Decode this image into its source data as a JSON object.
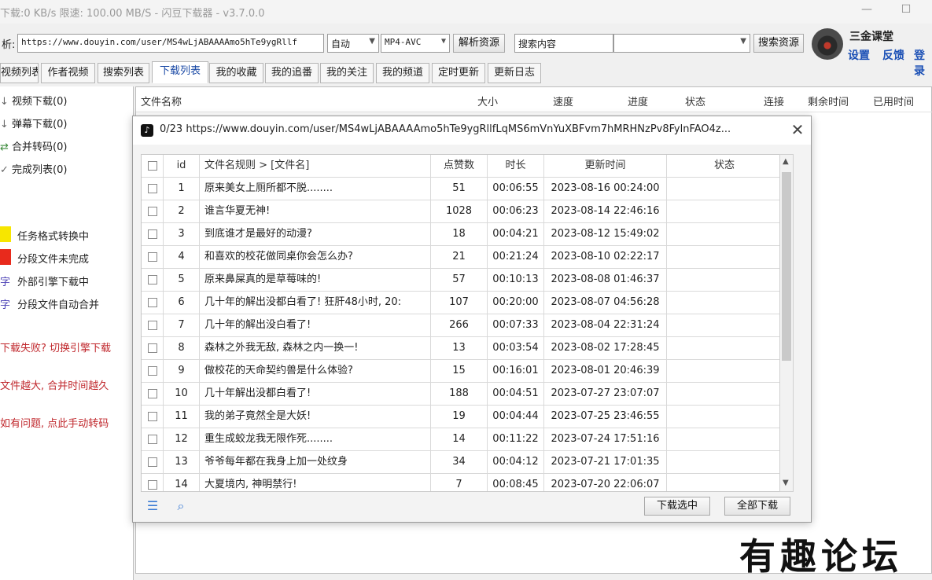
{
  "window": {
    "title": "下载:0 KB/s  限速: 100.00 MB/S  - 闪豆下载器 - v3.7.0.0"
  },
  "toolbar": {
    "parse_label": "析:",
    "url_value": "https://www.douyin.com/user/MS4wLjABAAAAmo5hTe9ygRllf",
    "mode_value": "自动",
    "format_value": "MP4-AVC",
    "parse_button": "解析资源",
    "search_input_value": "搜索内容",
    "search_select_value": "",
    "search_button": "搜索资源"
  },
  "user": {
    "name": "三金课堂",
    "settings": "设置",
    "feedback": "反馈",
    "login": "登录"
  },
  "tabs": [
    {
      "label": "视频列表"
    },
    {
      "label": "作者视频"
    },
    {
      "label": "搜索列表"
    },
    {
      "label": "下载列表"
    },
    {
      "label": "我的收藏"
    },
    {
      "label": "我的追番"
    },
    {
      "label": "我的关注"
    },
    {
      "label": "我的频道"
    },
    {
      "label": "定时更新"
    },
    {
      "label": "更新日志"
    }
  ],
  "sidebar": {
    "items": [
      {
        "icon": "↓",
        "label": "视频下载(0)"
      },
      {
        "icon": "↓",
        "label": "弹幕下载(0)"
      },
      {
        "icon": "⇄",
        "label": "合并转码(0)"
      },
      {
        "icon": "✓",
        "label": "完成列表(0)"
      }
    ],
    "legend": [
      {
        "color": "#f7e600",
        "label": "任务格式转换中"
      },
      {
        "color": "#e82a1c",
        "label": "分段文件未完成"
      },
      {
        "prefix": "字",
        "label": "外部引擎下载中"
      },
      {
        "prefix": "字",
        "label": "分段文件自动合并"
      }
    ],
    "tips": [
      "下载失败? 切换引擎下载",
      "文件越大, 合并时间越久",
      "如有问题, 点此手动转码"
    ]
  },
  "main_header": [
    "文件名称",
    "大小",
    "速度",
    "进度",
    "状态",
    "连接",
    "剩余时间",
    "已用时间"
  ],
  "dialog": {
    "title": "0/23 https://www.douyin.com/user/MS4wLjABAAAAmo5hTe9ygRllfLqMS6mVnYuXBFvm7hMRHNzPv8FylnFAO4z...",
    "columns": [
      "id",
      "文件名规则  >  [文件名]",
      "点赞数",
      "时长",
      "更新时间",
      "状态"
    ],
    "rows": [
      {
        "id": "1",
        "name": "原来美女上厕所都不脱........",
        "likes": "51",
        "duration": "00:06:55",
        "time": "2023-08-16 00:24:00",
        "status": ""
      },
      {
        "id": "2",
        "name": "谁言华夏无神!",
        "likes": "1028",
        "duration": "00:06:23",
        "time": "2023-08-14 22:46:16",
        "status": ""
      },
      {
        "id": "3",
        "name": "到底谁才是最好的动漫?",
        "likes": "18",
        "duration": "00:04:21",
        "time": "2023-08-12 15:49:02",
        "status": ""
      },
      {
        "id": "4",
        "name": "和喜欢的校花做同桌你会怎么办?",
        "likes": "21",
        "duration": "00:21:24",
        "time": "2023-08-10 02:22:17",
        "status": ""
      },
      {
        "id": "5",
        "name": "原来鼻屎真的是草莓味的!",
        "likes": "57",
        "duration": "00:10:13",
        "time": "2023-08-08 01:46:37",
        "status": ""
      },
      {
        "id": "6",
        "name": "几十年的解出没都白看了! 狂肝48小时, 20:",
        "likes": "107",
        "duration": "00:20:00",
        "time": "2023-08-07 04:56:28",
        "status": ""
      },
      {
        "id": "7",
        "name": "几十年的解出没白看了!",
        "likes": "266",
        "duration": "00:07:33",
        "time": "2023-08-04 22:31:24",
        "status": ""
      },
      {
        "id": "8",
        "name": "森林之外我无敌, 森林之内一换一!",
        "likes": "13",
        "duration": "00:03:54",
        "time": "2023-08-02 17:28:45",
        "status": ""
      },
      {
        "id": "9",
        "name": "做校花的天命契约兽是什么体验?",
        "likes": "15",
        "duration": "00:16:01",
        "time": "2023-08-01 20:46:39",
        "status": ""
      },
      {
        "id": "10",
        "name": "几十年解出没都白看了!",
        "likes": "188",
        "duration": "00:04:51",
        "time": "2023-07-27 23:07:07",
        "status": ""
      },
      {
        "id": "11",
        "name": "我的弟子竟然全是大妖!",
        "likes": "19",
        "duration": "00:04:44",
        "time": "2023-07-25 23:46:55",
        "status": ""
      },
      {
        "id": "12",
        "name": "重生成蛟龙我无限作死........",
        "likes": "14",
        "duration": "00:11:22",
        "time": "2023-07-24 17:51:16",
        "status": ""
      },
      {
        "id": "13",
        "name": "爷爷每年都在我身上加一处纹身",
        "likes": "34",
        "duration": "00:04:12",
        "time": "2023-07-21 17:01:35",
        "status": ""
      },
      {
        "id": "14",
        "name": "大夏境内, 神明禁行!",
        "likes": "7",
        "duration": "00:08:45",
        "time": "2023-07-20 22:06:07",
        "status": ""
      }
    ],
    "download_selected": "下载选中",
    "download_all": "全部下载"
  },
  "watermark": "有趣论坛"
}
